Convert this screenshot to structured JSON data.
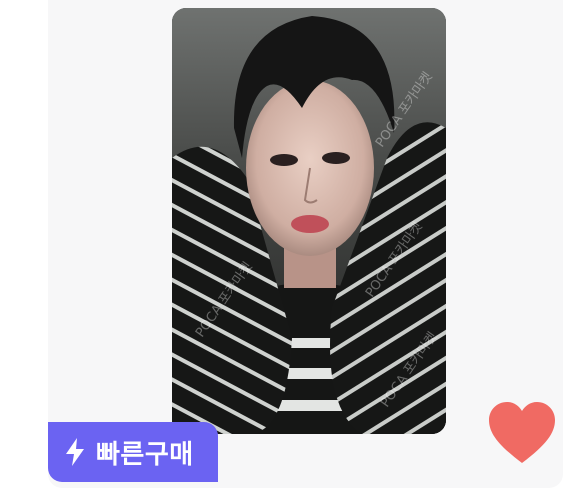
{
  "listing": {
    "quick_buy_label": "빠른구매",
    "photo_watermark_text": "POCA 포카마켓",
    "colors": {
      "accent": "#6b63f2",
      "heart": "#f06a63",
      "card_bg": "#f7f7f8"
    },
    "icons": {
      "quick_buy": "lightning-bolt-icon",
      "favorite": "heart-icon"
    },
    "favorited": true
  }
}
